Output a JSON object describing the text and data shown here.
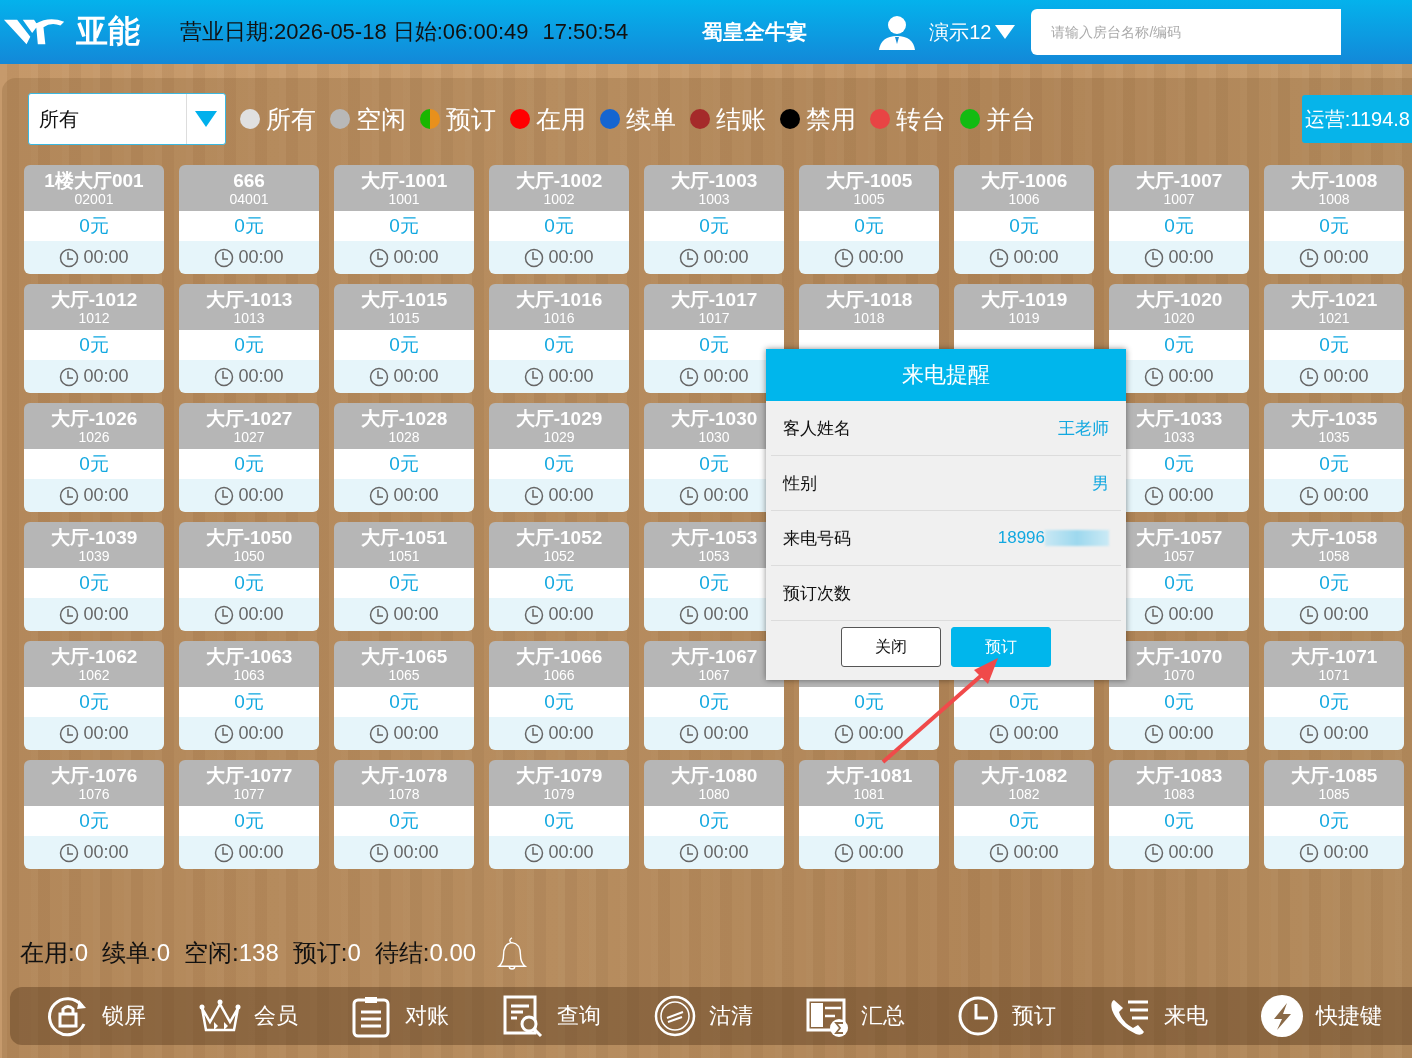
{
  "header": {
    "logo_text": "亚能",
    "business_date": "营业日期:2026-05-18 日始:06:00:49",
    "clock": "17:50:54",
    "restaurant": "蜀皇全牛宴",
    "user": "演示12",
    "search": {
      "placeholder": "请输入房台名称/编码"
    }
  },
  "filter": {
    "value": "所有"
  },
  "legend": [
    {
      "label": "所有",
      "color": "#e0e0e0"
    },
    {
      "label": "空闲",
      "color": "#b8b8b8"
    },
    {
      "label": "预订",
      "halves": [
        {
          "color": "#19b600"
        },
        {
          "color": "#e8901c"
        }
      ]
    },
    {
      "label": "在用",
      "color": "#ff0000"
    },
    {
      "label": "续单",
      "color": "#1565d0"
    },
    {
      "label": "结账",
      "color": "#a52a2a"
    },
    {
      "label": "禁用",
      "color": "#000000"
    },
    {
      "label": "转台",
      "color": "#e84444"
    },
    {
      "label": "并台",
      "color": "#12bb12"
    }
  ],
  "operations": "运营:1194.8",
  "room_rows": [
    {
      "left": [
        {
          "name": "1楼大厅001",
          "code": "02001",
          "amount": "0元",
          "time": "00:00"
        },
        {
          "name": "666",
          "code": "04001",
          "amount": "0元",
          "time": "00:00"
        },
        {
          "name": "大厅-1001",
          "code": "1001",
          "amount": "0元",
          "time": "00:00"
        },
        {
          "name": "大厅-1002",
          "code": "1002",
          "amount": "0元",
          "time": "00:00"
        },
        {
          "name": "大厅-1003",
          "code": "1003",
          "amount": "0元",
          "time": "00:00"
        },
        {
          "name": "大厅-1005",
          "code": "1005",
          "amount": "0元",
          "time": "00:00"
        },
        {
          "name": "大厅-1006",
          "code": "1006",
          "amount": "0元",
          "time": "00:00"
        },
        {
          "name": "大厅-1007",
          "code": "1007",
          "amount": "0元",
          "time": "00:00"
        },
        {
          "name": "大厅-1008",
          "code": "1008",
          "amount": "0元",
          "time": "00:00"
        }
      ]
    },
    {
      "left": [
        {
          "name": "大厅-1012",
          "code": "1012",
          "amount": "0元",
          "time": "00:00"
        },
        {
          "name": "大厅-1013",
          "code": "1013",
          "amount": "0元",
          "time": "00:00"
        },
        {
          "name": "大厅-1015",
          "code": "1015",
          "amount": "0元",
          "time": "00:00"
        },
        {
          "name": "大厅-1016",
          "code": "1016",
          "amount": "0元",
          "time": "00:00"
        },
        {
          "name": "大厅-1017",
          "code": "1017",
          "amount": "0元",
          "time": "00:00"
        },
        {
          "name": "大厅-1018",
          "code": "1018"
        },
        {
          "name": "大厅-1019",
          "code": "1019"
        },
        {
          "name": "大厅-1020",
          "code": "1020",
          "amount": "0元",
          "time": "00:00"
        },
        {
          "name": "大厅-1021",
          "code": "1021",
          "amount": "0元",
          "time": "00:00"
        }
      ]
    },
    {
      "left": [
        {
          "name": "大厅-1026",
          "code": "1026",
          "amount": "0元",
          "time": "00:00"
        },
        {
          "name": "大厅-1027",
          "code": "1027",
          "amount": "0元",
          "time": "00:00"
        },
        {
          "name": "大厅-1028",
          "code": "1028",
          "amount": "0元",
          "time": "00:00"
        },
        {
          "name": "大厅-1029",
          "code": "1029",
          "amount": "0元",
          "time": "00:00"
        },
        {
          "name": "大厅-1030",
          "code": "1030",
          "amount": "0元",
          "time": "00:00"
        }
      ],
      "right": [
        {
          "name": "大厅-1033",
          "code": "1033",
          "amount": "0元",
          "time": "00:00"
        },
        {
          "name": "大厅-1035",
          "code": "1035",
          "amount": "0元",
          "time": "00:00"
        }
      ]
    },
    {
      "left": [
        {
          "name": "大厅-1039",
          "code": "1039",
          "amount": "0元",
          "time": "00:00"
        },
        {
          "name": "大厅-1050",
          "code": "1050",
          "amount": "0元",
          "time": "00:00"
        },
        {
          "name": "大厅-1051",
          "code": "1051",
          "amount": "0元",
          "time": "00:00"
        },
        {
          "name": "大厅-1052",
          "code": "1052",
          "amount": "0元",
          "time": "00:00"
        },
        {
          "name": "大厅-1053",
          "code": "1053",
          "amount": "0元",
          "time": "00:00"
        }
      ],
      "right": [
        {
          "name": "大厅-1057",
          "code": "1057",
          "amount": "0元",
          "time": "00:00"
        },
        {
          "name": "大厅-1058",
          "code": "1058",
          "amount": "0元",
          "time": "00:00"
        }
      ]
    },
    {
      "left": [
        {
          "name": "大厅-1062",
          "code": "1062",
          "amount": "0元",
          "time": "00:00"
        },
        {
          "name": "大厅-1063",
          "code": "1063",
          "amount": "0元",
          "time": "00:00"
        },
        {
          "name": "大厅-1065",
          "code": "1065",
          "amount": "0元",
          "time": "00:00"
        },
        {
          "name": "大厅-1066",
          "code": "1066",
          "amount": "0元",
          "time": "00:00"
        },
        {
          "name": "大厅-1067",
          "code": "1067",
          "amount": "0元",
          "time": "00:00"
        },
        {
          "amount": "0元",
          "time": "00:00"
        },
        {
          "amount": "0元",
          "time": "00:00"
        },
        {
          "name": "大厅-1070",
          "code": "1070",
          "amount": "0元",
          "time": "00:00"
        },
        {
          "name": "大厅-1071",
          "code": "1071",
          "amount": "0元",
          "time": "00:00"
        }
      ]
    },
    {
      "left": [
        {
          "name": "大厅-1076",
          "code": "1076",
          "amount": "0元",
          "time": "00:00"
        },
        {
          "name": "大厅-1077",
          "code": "1077",
          "amount": "0元",
          "time": "00:00"
        },
        {
          "name": "大厅-1078",
          "code": "1078",
          "amount": "0元",
          "time": "00:00"
        },
        {
          "name": "大厅-1079",
          "code": "1079",
          "amount": "0元",
          "time": "00:00"
        },
        {
          "name": "大厅-1080",
          "code": "1080",
          "amount": "0元",
          "time": "00:00"
        },
        {
          "name": "大厅-1081",
          "code": "1081",
          "amount": "0元",
          "time": "00:00"
        },
        {
          "name": "大厅-1082",
          "code": "1082",
          "amount": "0元",
          "time": "00:00"
        },
        {
          "name": "大厅-1083",
          "code": "1083",
          "amount": "0元",
          "time": "00:00"
        },
        {
          "name": "大厅-1085",
          "code": "1085",
          "amount": "0元",
          "time": "00:00"
        }
      ]
    }
  ],
  "status": [
    {
      "label": "在用:",
      "value": "0"
    },
    {
      "label": "续单:",
      "value": "0"
    },
    {
      "label": "空闲:",
      "value": "138"
    },
    {
      "label": "预订:",
      "value": "0"
    },
    {
      "label": "待结:",
      "value": "0.00"
    }
  ],
  "toolbar": [
    {
      "label": "锁屏",
      "kind": "lock"
    },
    {
      "label": "会员",
      "kind": "crown"
    },
    {
      "label": "对账",
      "kind": "clipboard"
    },
    {
      "label": "查询",
      "kind": "search"
    },
    {
      "label": "沽清",
      "kind": "stamp"
    },
    {
      "label": "汇总",
      "kind": "summary"
    },
    {
      "label": "预订",
      "kind": "clock"
    },
    {
      "label": "来电",
      "kind": "phone"
    },
    {
      "label": "快捷键",
      "kind": "bolt"
    }
  ],
  "dialog": {
    "title": "来电提醒",
    "fields": [
      {
        "label": "客人姓名",
        "value": "王老师",
        "redacted": false
      },
      {
        "label": "性别",
        "value": "男",
        "redacted": false
      },
      {
        "label": "来电号码",
        "value": "18996",
        "redacted": true
      },
      {
        "label": "预订次数",
        "redacted": false
      }
    ],
    "buttons": [
      {
        "label": "关闭",
        "primary": false
      },
      {
        "label": "预订",
        "primary": true
      }
    ]
  }
}
